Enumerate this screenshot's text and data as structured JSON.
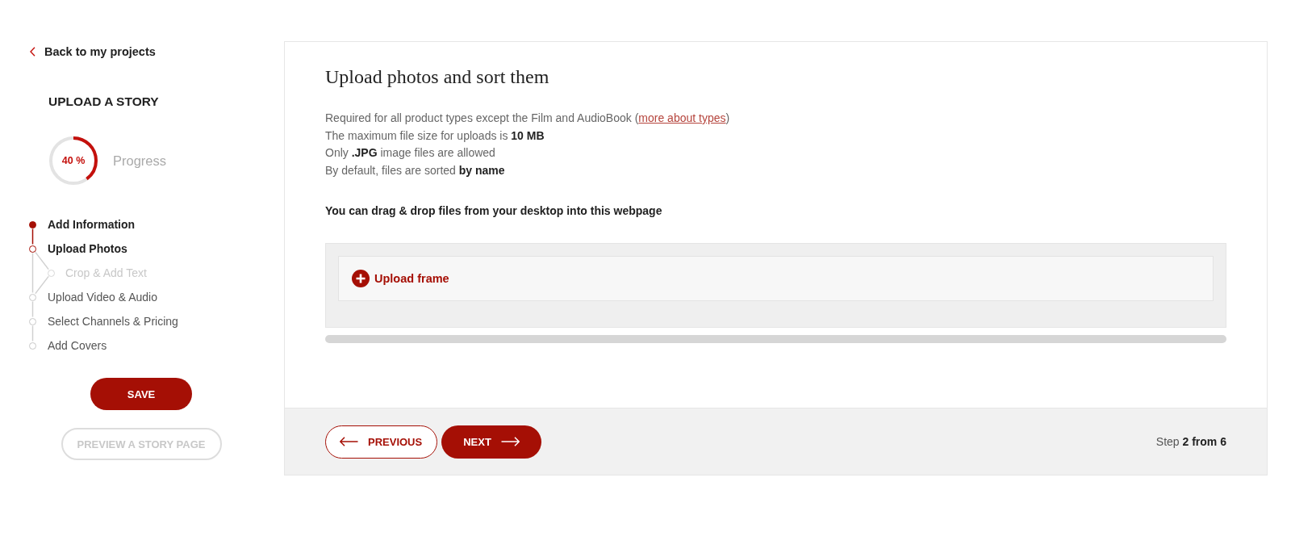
{
  "back_link": {
    "label": "Back to my projects"
  },
  "sidebar": {
    "title": "UPLOAD A STORY",
    "progress": {
      "value": "40 %",
      "level": 0.4,
      "label": "Progress"
    },
    "steps": [
      {
        "label": "Add Information",
        "completed": true,
        "selected": false,
        "disabled": false
      },
      {
        "label": "Upload Photos",
        "completed": false,
        "selected": true,
        "disabled": false,
        "children": [
          {
            "label": "Crop & Add Text",
            "completed": false,
            "selected": false,
            "disabled": true
          }
        ]
      },
      {
        "label": "Upload Video & Audio",
        "completed": false,
        "selected": false,
        "disabled": false
      },
      {
        "label": "Select Channels & Pricing",
        "completed": false,
        "selected": false,
        "disabled": false
      },
      {
        "label": "Add Covers",
        "completed": false,
        "selected": false,
        "disabled": false
      }
    ],
    "buttons": [
      {
        "label": "SAVE",
        "kind": "primary",
        "disabled": false
      },
      {
        "label": "PREVIEW A STORY PAGE",
        "kind": "secondary",
        "disabled": true
      }
    ]
  },
  "main": {
    "title": "Upload photos and sort them",
    "info_lines": [
      {
        "text": "Required for all product types except the Film and AudioBook (",
        "link": "more about types",
        "text_after": ")"
      },
      {
        "text": "The maximum file size for uploads is **10 MB**"
      },
      {
        "text": "Only **.JPG** image files are allowed"
      },
      {
        "text": "By default, files are sorted **by name**"
      }
    ],
    "drop_hint": "You can drag & drop files from your desktop into this webpage",
    "upload": {
      "button": "Upload frame"
    },
    "footer": {
      "buttons": [
        {
          "label": "PREVIOUS",
          "kind": "previous"
        },
        {
          "label": "NEXT",
          "kind": "next"
        }
      ],
      "step": "Step **2 from 6**"
    }
  }
}
